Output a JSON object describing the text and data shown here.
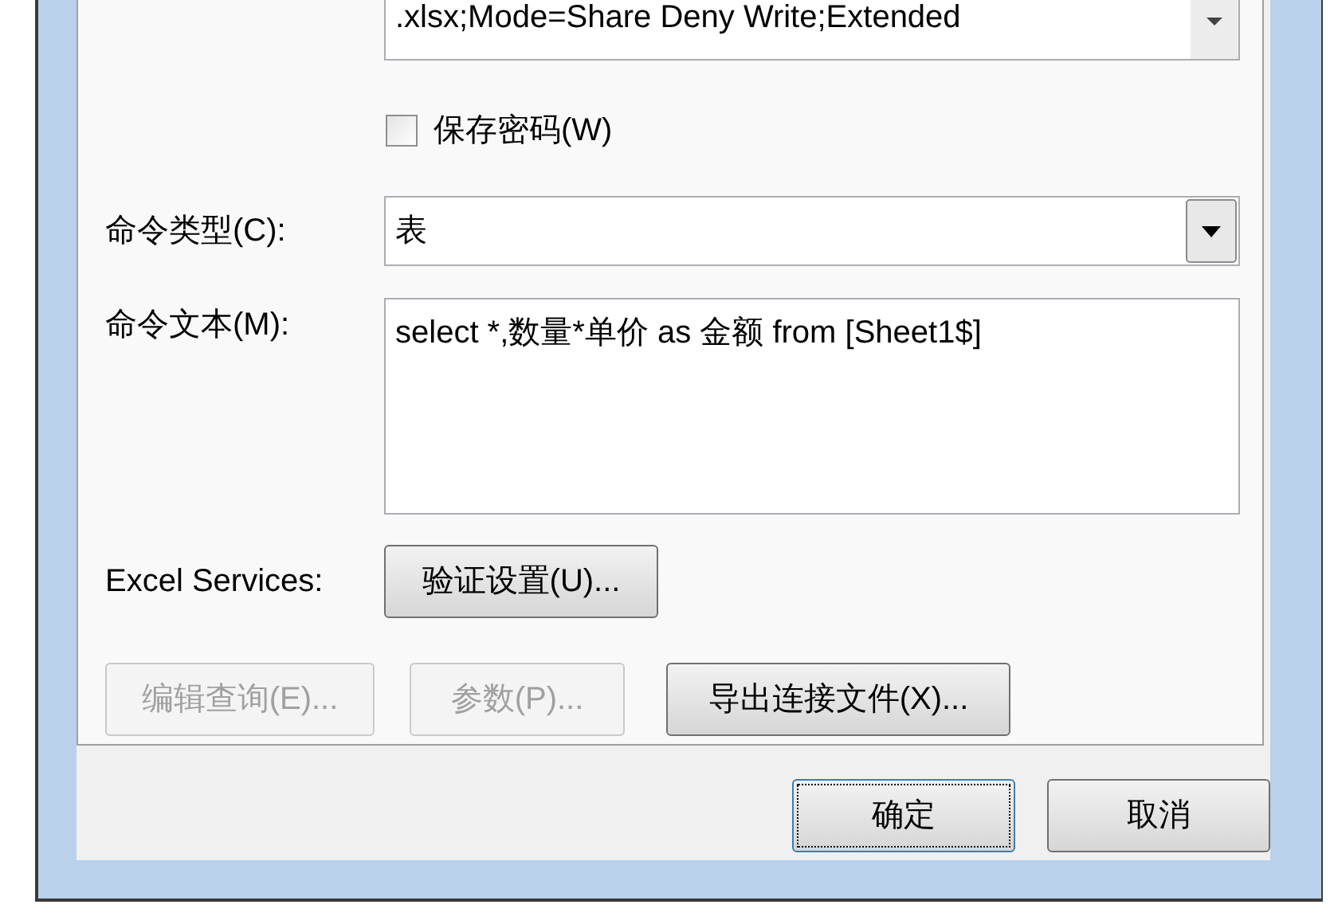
{
  "connection_string": {
    "text": ".xlsx;Mode=Share Deny Write;Extended"
  },
  "save_password": {
    "label": "保存密码(W)",
    "checked": false
  },
  "command_type": {
    "label": "命令类型(C):",
    "value": "表"
  },
  "command_text": {
    "label": "命令文本(M):",
    "value": "select *,数量*单价 as 金额 from [Sheet1$]"
  },
  "excel_services": {
    "label": "Excel Services:",
    "button": "验证设置(U)..."
  },
  "actions": [
    {
      "label": "编辑查询(E)...",
      "disabled": true
    },
    {
      "label": "参数(P)...",
      "disabled": true
    },
    {
      "label": "导出连接文件(X)...",
      "disabled": false
    }
  ],
  "footer_buttons": [
    {
      "label": "确定",
      "default": true
    },
    {
      "label": "取消",
      "default": false
    }
  ]
}
